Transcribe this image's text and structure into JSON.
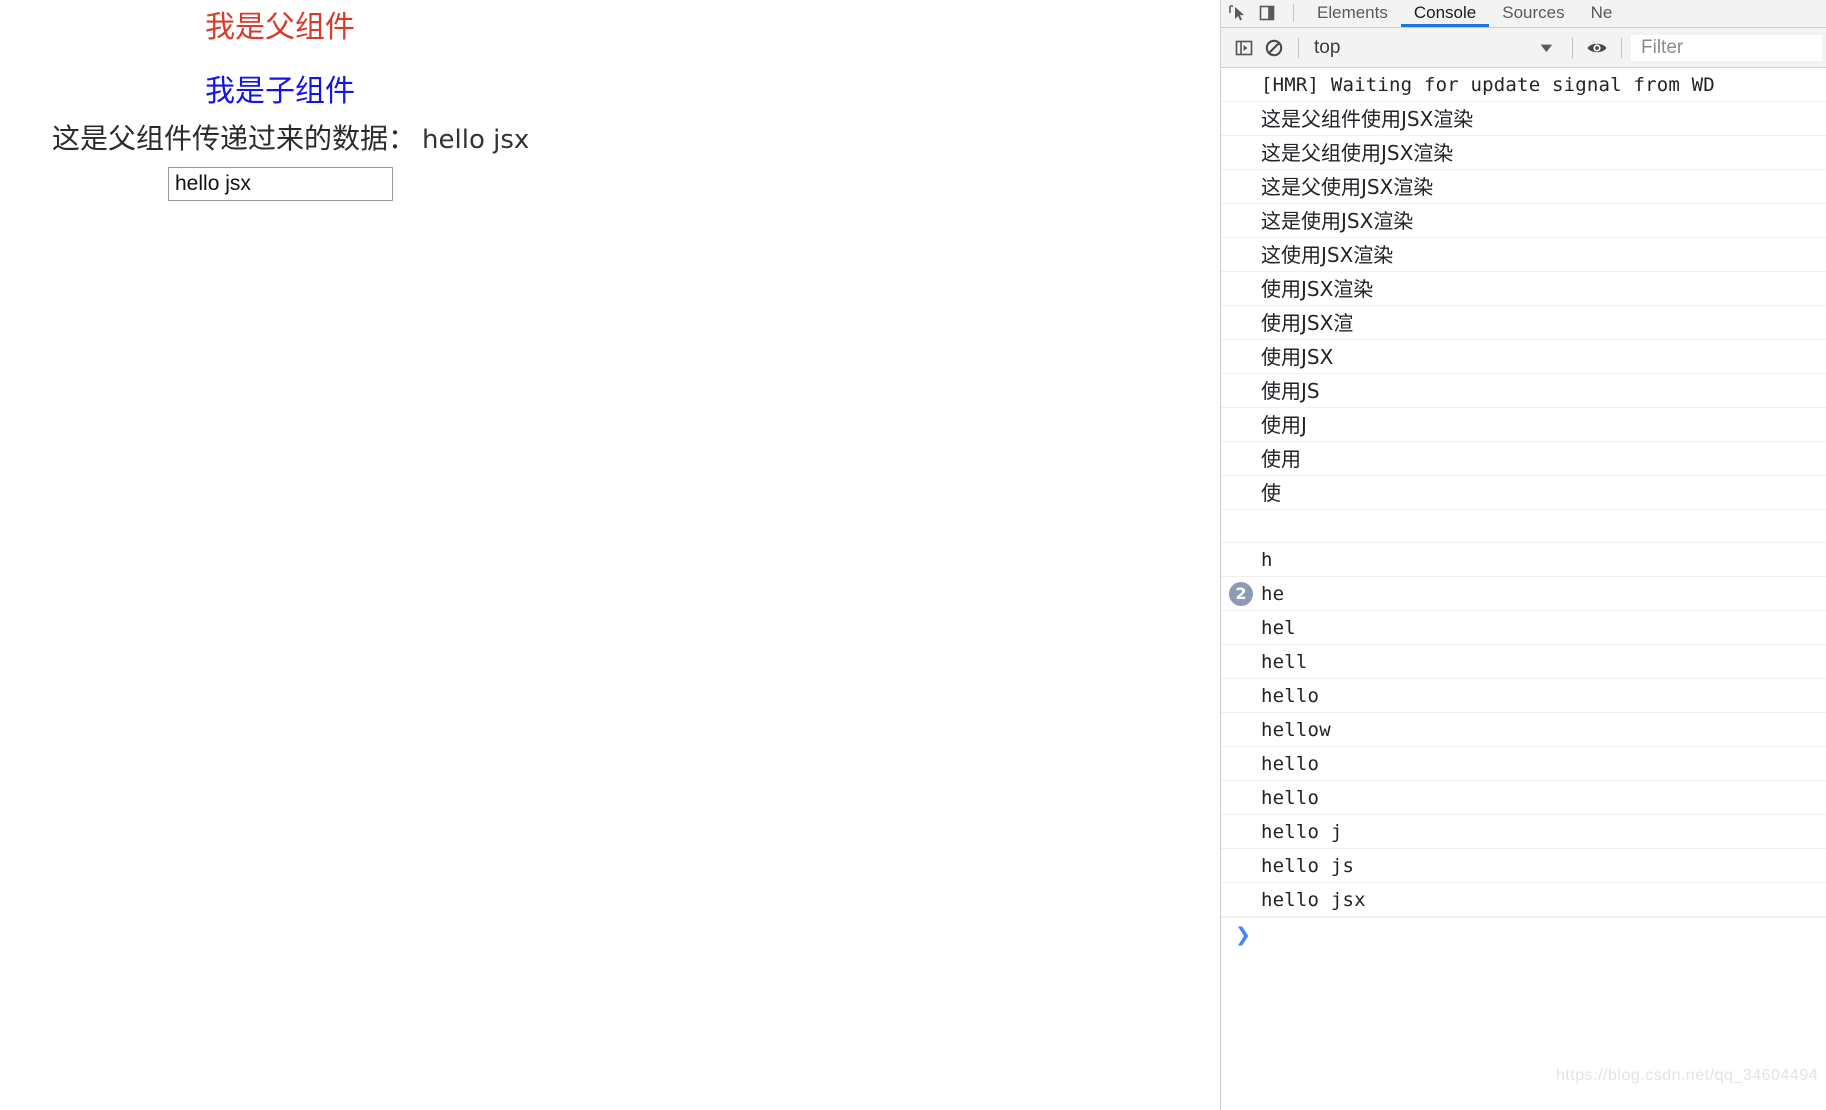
{
  "page": {
    "parent_title": "我是父组件",
    "child_title": "我是子组件",
    "child_data_label": "这是父组件传递过来的数据：",
    "child_data_value": "hello jsx",
    "input_value": "hello jsx",
    "input_placeholder": "",
    "colors": {
      "parent_title": "#d93b2b",
      "child_title": "#1313ee",
      "body_text": "#2b2b2b"
    }
  },
  "devtools": {
    "tabs": [
      {
        "label": "Elements",
        "active": false
      },
      {
        "label": "Console",
        "active": true
      },
      {
        "label": "Sources",
        "active": false
      },
      {
        "label": "Ne",
        "active": false
      }
    ],
    "toolbar": {
      "sidebar_toggle": "show-console-sidebar-icon",
      "clear_console": "clear-console-icon",
      "context": "top",
      "context_caret": "▼",
      "eye": "live-expression-icon",
      "filter_placeholder": "Filter"
    },
    "accent_color": "#1a73e8",
    "prompt": "❯",
    "watermark": "https://blog.csdn.net/qq_34604494",
    "logs": [
      {
        "text": "[HMR] Waiting for update signal from WD",
        "style": "mono",
        "count": null
      },
      {
        "text": "这是父组件使用JSX渲染",
        "style": "cjk",
        "count": null
      },
      {
        "text": "这是父组使用JSX渲染",
        "style": "cjk",
        "count": null
      },
      {
        "text": "这是父使用JSX渲染",
        "style": "cjk",
        "count": null
      },
      {
        "text": "这是使用JSX渲染",
        "style": "cjk",
        "count": null
      },
      {
        "text": "这使用JSX渲染",
        "style": "cjk",
        "count": null
      },
      {
        "text": "使用JSX渲染",
        "style": "cjk",
        "count": null
      },
      {
        "text": "使用JSX渲",
        "style": "cjk",
        "count": null
      },
      {
        "text": "使用JSX",
        "style": "cjk",
        "count": null
      },
      {
        "text": "使用JS",
        "style": "cjk",
        "count": null
      },
      {
        "text": "使用J",
        "style": "cjk",
        "count": null
      },
      {
        "text": "使用",
        "style": "cjk",
        "count": null
      },
      {
        "text": "使",
        "style": "cjk",
        "count": null
      },
      {
        "text": "",
        "style": "mono",
        "count": null
      },
      {
        "text": "h",
        "style": "mono",
        "count": null
      },
      {
        "text": "he",
        "style": "mono",
        "count": "2"
      },
      {
        "text": "hel",
        "style": "mono",
        "count": null
      },
      {
        "text": "hell",
        "style": "mono",
        "count": null
      },
      {
        "text": "hello",
        "style": "mono",
        "count": null
      },
      {
        "text": "hellow",
        "style": "mono",
        "count": null
      },
      {
        "text": "hello",
        "style": "mono",
        "count": null
      },
      {
        "text": "hello",
        "style": "mono",
        "count": null
      },
      {
        "text": "hello j",
        "style": "mono",
        "count": null
      },
      {
        "text": "hello js",
        "style": "mono",
        "count": null
      },
      {
        "text": "hello jsx",
        "style": "mono",
        "count": null
      }
    ]
  }
}
